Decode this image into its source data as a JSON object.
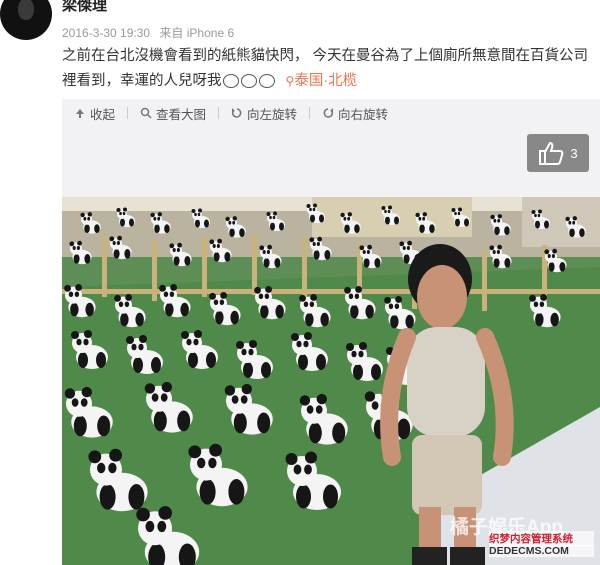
{
  "author": {
    "name": "梁傑理"
  },
  "meta": {
    "date": "2016-3-30 19:30",
    "source": "来自 iPhone 6"
  },
  "post": {
    "text": "之前在台北沒機會看到的紙熊貓快閃， 今天在曼谷為了上個廁所無意間在百貨公司裡看到，幸運的人兒呀我",
    "location_icon": "location-pin-icon",
    "location": "泰国·北榄"
  },
  "toolbar": {
    "collapse": "收起",
    "view_large": "查看大图",
    "rotate_left": "向左旋转",
    "rotate_right": "向右旋转"
  },
  "like": {
    "count": "3"
  },
  "watermark": {
    "line1": "橘子娱乐App",
    "line2": "织梦内容管理系统",
    "line3": "DEDECMS.COM"
  },
  "colors": {
    "accent": "#eb7350",
    "toolbar_bg": "#f2f2f5",
    "like_bg": "#888888"
  }
}
